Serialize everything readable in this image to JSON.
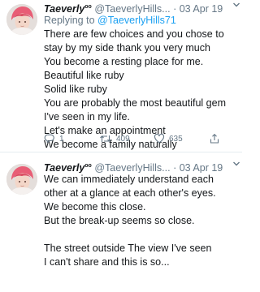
{
  "tweets": [
    {
      "display_name": "Taeverly",
      "name_badge": "oo",
      "handle": "@TaeverlyHills...",
      "separator": "·",
      "date": "03 Apr 19",
      "replying_prefix": "Replying to",
      "replying_to": "@TaeverlyHills71",
      "lines": [
        "There are few choices and you chose to",
        "stay by my side thank you very much",
        "You become a resting place for me.",
        "Beautiful like ruby",
        "Solid like ruby",
        "You are probably the most beautiful gem",
        "I've seen in my life.",
        "Let's make an appointment",
        "We become a family naturally"
      ],
      "reply_count": "1",
      "retweet_count": "409",
      "like_count": "635"
    },
    {
      "display_name": "Taeverly",
      "name_badge": "oo",
      "handle": "@TaeverlyHills...",
      "separator": "·",
      "date": "03 Apr 19",
      "lines": [
        "We can immediately understand each",
        "other at a glance at each other's eyes.",
        "We become this close.",
        "But the break-up seems so close.",
        "",
        "The street outside The view I've seen",
        "I can't share and this is so..."
      ]
    }
  ],
  "icons": {
    "caret": "chevron-down-icon",
    "reply": "reply-icon",
    "retweet": "retweet-icon",
    "like": "heart-icon",
    "share": "share-icon"
  },
  "colors": {
    "text": "#14171a",
    "muted": "#657786",
    "link": "#1da1f2",
    "divider": "#e6ecf0"
  }
}
